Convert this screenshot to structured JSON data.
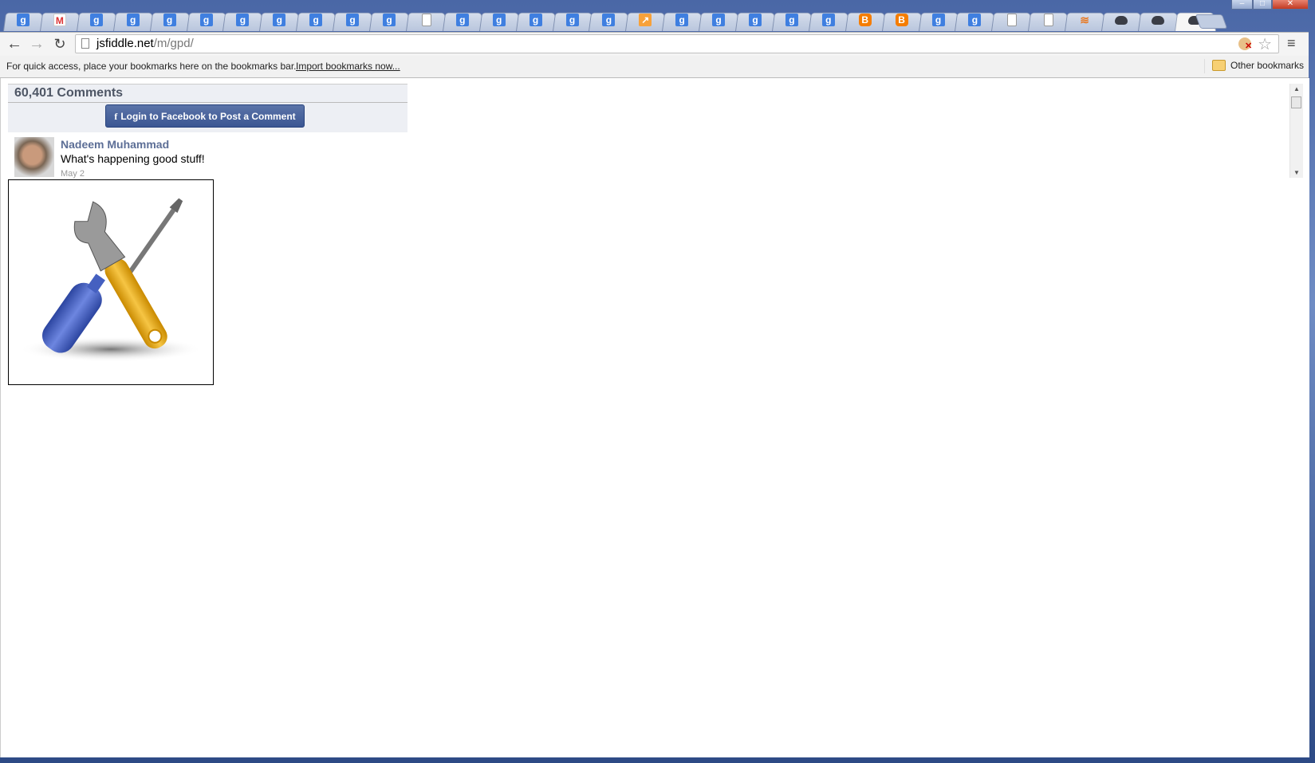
{
  "browser": {
    "tabs": [
      {
        "icon": "google-icon"
      },
      {
        "icon": "gmail-icon"
      },
      {
        "icon": "google-icon"
      },
      {
        "icon": "google-icon"
      },
      {
        "icon": "google-icon"
      },
      {
        "icon": "google-icon"
      },
      {
        "icon": "google-icon"
      },
      {
        "icon": "google-icon"
      },
      {
        "icon": "google-icon"
      },
      {
        "icon": "google-icon"
      },
      {
        "icon": "google-icon"
      },
      {
        "icon": "document-icon"
      },
      {
        "icon": "google-icon"
      },
      {
        "icon": "google-icon"
      },
      {
        "icon": "google-icon"
      },
      {
        "icon": "google-icon"
      },
      {
        "icon": "google-icon"
      },
      {
        "icon": "chart-icon"
      },
      {
        "icon": "google-icon"
      },
      {
        "icon": "google-icon"
      },
      {
        "icon": "google-icon"
      },
      {
        "icon": "google-icon"
      },
      {
        "icon": "google-icon"
      },
      {
        "icon": "blogger-icon"
      },
      {
        "icon": "blogger-icon"
      },
      {
        "icon": "google-icon"
      },
      {
        "icon": "google-icon"
      },
      {
        "icon": "document-icon"
      },
      {
        "icon": "document-icon"
      },
      {
        "icon": "stackoverflow-icon"
      },
      {
        "icon": "jsfiddle-icon"
      },
      {
        "icon": "jsfiddle-icon"
      },
      {
        "icon": "jsfiddle-icon",
        "active": true
      }
    ],
    "url_host": "jsfiddle.net",
    "url_path": "/m/gpd/",
    "bookmarks_hint": "For quick access, place your bookmarks here on the bookmarks bar.",
    "import_link": "Import bookmarks now...",
    "other_bookmarks": "Other bookmarks"
  },
  "comments": {
    "count_label": "60,401 Comments",
    "login_button": "Login to Facebook to Post a Comment",
    "fb_glyph": "f",
    "items": [
      {
        "author": "Nadeem Muhammad",
        "text": "What's happening good stuff!",
        "date": "May 2"
      }
    ]
  },
  "colors": {
    "facebook_blue": "#3b5998",
    "author_link": "#5c6e96"
  }
}
